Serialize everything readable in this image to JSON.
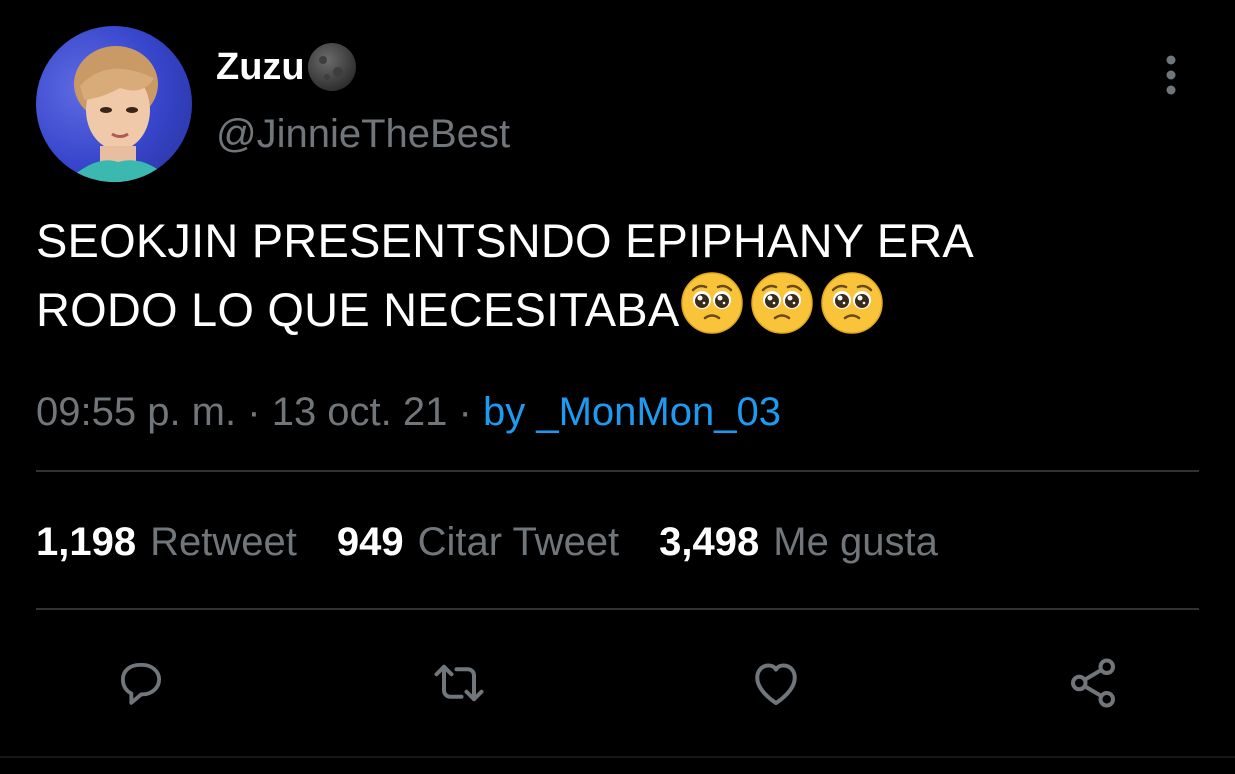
{
  "author": {
    "display_name": "Zuzu",
    "handle": "@JinnieTheBest",
    "badge_icon": "new-moon-emoji-icon"
  },
  "tweet": {
    "text_line1": "SEOKJIN PRESENTSNDO EPIPHANY ERA",
    "text_line2": "RODO LO QUE NECESITABA",
    "emojis": [
      "pleading-face-emoji-icon",
      "pleading-face-emoji-icon",
      "pleading-face-emoji-icon"
    ]
  },
  "meta": {
    "time": "09:55 p. m.",
    "separator": "·",
    "date": "13 oct. 21",
    "source": "by _MonMon_03"
  },
  "stats": {
    "retweets_count": "1,198",
    "retweets_label": "Retweet",
    "quotes_count": "949",
    "quotes_label": "Citar Tweet",
    "likes_count": "3,498",
    "likes_label": "Me gusta"
  },
  "actions": [
    "reply-icon",
    "retweet-icon",
    "like-icon",
    "share-icon"
  ],
  "colors": {
    "background": "#000000",
    "text_primary": "#ffffff",
    "text_secondary": "#71767b",
    "accent": "#1d9bf0",
    "divider": "#2f3336"
  }
}
